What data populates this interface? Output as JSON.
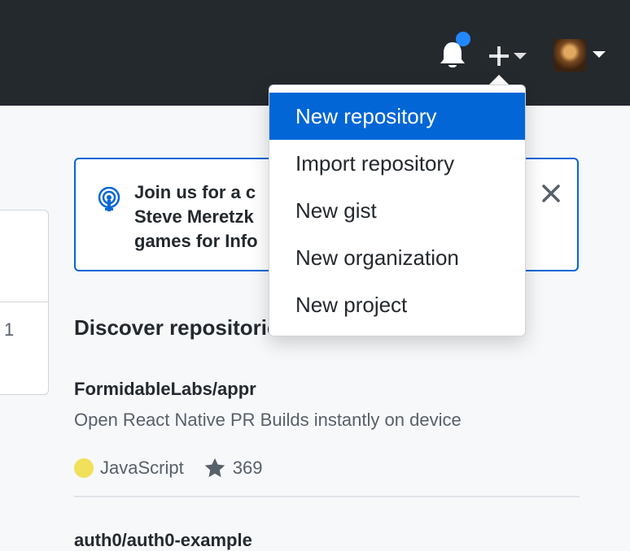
{
  "header": {
    "notifications_icon": "bell-icon",
    "create_icon": "plus-icon",
    "avatar_alt": "user avatar"
  },
  "create_menu": {
    "items": [
      {
        "label": "New repository",
        "active": true
      },
      {
        "label": "Import repository",
        "active": false
      },
      {
        "label": "New gist",
        "active": false
      },
      {
        "label": "New organization",
        "active": false
      },
      {
        "label": "New project",
        "active": false
      }
    ]
  },
  "left_card": {
    "count": "1"
  },
  "announcement": {
    "lines": [
      "Join us for a c",
      "Steve Meretzk",
      "games for Info"
    ]
  },
  "discover": {
    "title": "Discover repositories",
    "repos": [
      {
        "name": "FormidableLabs/appr",
        "description": "Open React Native PR Builds instantly on device",
        "language": "JavaScript",
        "language_color": "#f1e05a",
        "stars": "369"
      },
      {
        "name": "auth0/auth0-example"
      }
    ]
  },
  "colors": {
    "header_bg": "#24292e",
    "accent": "#0366d6",
    "notification_dot": "#2188ff"
  }
}
